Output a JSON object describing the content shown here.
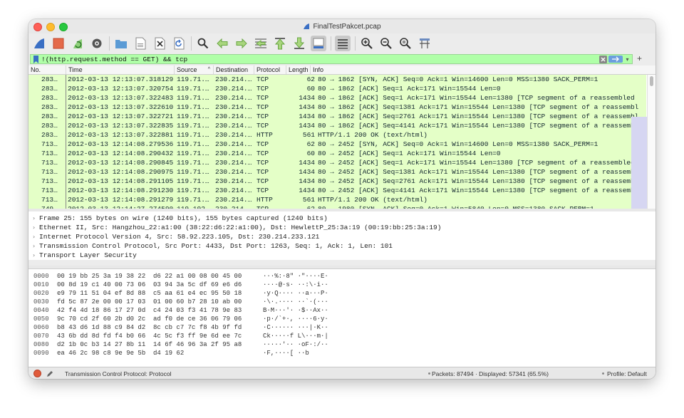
{
  "window": {
    "title": "FinalTestPakcet.pcap"
  },
  "toolbar": {
    "buttons": [
      "shark-fin-icon",
      "stop-capture-icon",
      "restart-capture-icon",
      "capture-options-icon",
      "open-file-icon",
      "save-file-icon",
      "close-file-icon",
      "reload-file-icon",
      "find-packet-icon",
      "go-back-icon",
      "go-forward-icon",
      "go-to-packet-icon",
      "go-first-icon",
      "go-last-icon",
      "auto-scroll-icon",
      "colorize-icon",
      "zoom-in-icon",
      "zoom-out-icon",
      "zoom-normal-icon",
      "resize-columns-icon"
    ]
  },
  "filter": {
    "value": "!(http.request.method == GET) && tcp",
    "add_label": "+"
  },
  "packet_list": {
    "columns": [
      "No.",
      "Time",
      "Source",
      "Destination",
      "Protocol",
      "Length",
      "Info"
    ],
    "rows": [
      {
        "no": "283…",
        "time": "2012-03-13 12:13:07.318129",
        "src": "119.71.…",
        "dst": "230.214.…",
        "proto": "TCP",
        "len": "62",
        "info": "80 → 1862 [SYN, ACK] Seq=0 Ack=1 Win=14600 Len=0 MSS=1380 SACK_PERM=1"
      },
      {
        "no": "283…",
        "time": "2012-03-13 12:13:07.320754",
        "src": "119.71.…",
        "dst": "230.214.…",
        "proto": "TCP",
        "len": "60",
        "info": "80 → 1862 [ACK] Seq=1 Ack=171 Win=15544 Len=0"
      },
      {
        "no": "283…",
        "time": "2012-03-13 12:13:07.322483",
        "src": "119.71.…",
        "dst": "230.214.…",
        "proto": "TCP",
        "len": "1434",
        "info": "80 → 1862 [ACK] Seq=1 Ack=171 Win=15544 Len=1380 [TCP segment of a reassembled"
      },
      {
        "no": "283…",
        "time": "2012-03-13 12:13:07.322610",
        "src": "119.71.…",
        "dst": "230.214.…",
        "proto": "TCP",
        "len": "1434",
        "info": "80 → 1862 [ACK] Seq=1381 Ack=171 Win=15544 Len=1380 [TCP segment of a reassembl"
      },
      {
        "no": "283…",
        "time": "2012-03-13 12:13:07.322721",
        "src": "119.71.…",
        "dst": "230.214.…",
        "proto": "TCP",
        "len": "1434",
        "info": "80 → 1862 [ACK] Seq=2761 Ack=171 Win=15544 Len=1380 [TCP segment of a reassembl"
      },
      {
        "no": "283…",
        "time": "2012-03-13 12:13:07.322835",
        "src": "119.71.…",
        "dst": "230.214.…",
        "proto": "TCP",
        "len": "1434",
        "info": "80 → 1862 [ACK] Seq=4141 Ack=171 Win=15544 Len=1380 [TCP segment of a reassembl"
      },
      {
        "no": "283…",
        "time": "2012-03-13 12:13:07.322881",
        "src": "119.71.…",
        "dst": "230.214.…",
        "proto": "HTTP",
        "len": "561",
        "info": "HTTP/1.1 200 OK  (text/html)"
      },
      {
        "no": "713…",
        "time": "2012-03-13 12:14:08.279536",
        "src": "119.71.…",
        "dst": "230.214.…",
        "proto": "TCP",
        "len": "62",
        "info": "80 → 2452 [SYN, ACK] Seq=0 Ack=1 Win=14600 Len=0 MSS=1380 SACK_PERM=1"
      },
      {
        "no": "713…",
        "time": "2012-03-13 12:14:08.290432",
        "src": "119.71.…",
        "dst": "230.214.…",
        "proto": "TCP",
        "len": "60",
        "info": "80 → 2452 [ACK] Seq=1 Ack=171 Win=15544 Len=0"
      },
      {
        "no": "713…",
        "time": "2012-03-13 12:14:08.290845",
        "src": "119.71.…",
        "dst": "230.214.…",
        "proto": "TCP",
        "len": "1434",
        "info": "80 → 2452 [ACK] Seq=1 Ack=171 Win=15544 Len=1380 [TCP segment of a reassembled"
      },
      {
        "no": "713…",
        "time": "2012-03-13 12:14:08.290975",
        "src": "119.71.…",
        "dst": "230.214.…",
        "proto": "TCP",
        "len": "1434",
        "info": "80 → 2452 [ACK] Seq=1381 Ack=171 Win=15544 Len=1380 [TCP segment of a reassembl"
      },
      {
        "no": "713…",
        "time": "2012-03-13 12:14:08.291105",
        "src": "119.71.…",
        "dst": "230.214.…",
        "proto": "TCP",
        "len": "1434",
        "info": "80 → 2452 [ACK] Seq=2761 Ack=171 Win=15544 Len=1380 [TCP segment of a reassembl"
      },
      {
        "no": "713…",
        "time": "2012-03-13 12:14:08.291230",
        "src": "119.71.…",
        "dst": "230.214.…",
        "proto": "TCP",
        "len": "1434",
        "info": "80 → 2452 [ACK] Seq=4141 Ack=171 Win=15544 Len=1380 [TCP segment of a reassembl"
      },
      {
        "no": "713…",
        "time": "2012-03-13 12:14:08.291279",
        "src": "119.71.…",
        "dst": "230.214.…",
        "proto": "HTTP",
        "len": "561",
        "info": "HTTP/1.1 200 OK  (text/html)"
      },
      {
        "no": "749…",
        "time": "2012-03-13 12:14:27.274590",
        "src": "119.192.…",
        "dst": "230.214.…",
        "proto": "TCP",
        "len": "62",
        "info": "80 → 1980 [SYN, ACK] Seq=0 Ack=1 Win=5840 Len=0 MSS=1380 SACK_PERM=1"
      }
    ]
  },
  "details": [
    "Frame 25: 155 bytes on wire (1240 bits), 155 bytes captured (1240 bits)",
    "Ethernet II, Src: Hangzhou_22:a1:00 (38:22:d6:22:a1:00), Dst: HewlettP_25:3a:19 (00:19:bb:25:3a:19)",
    "Internet Protocol Version 4, Src: 58.92.223.105, Dst: 230.214.233.121",
    "Transmission Control Protocol, Src Port: 4433, Dst Port: 1263, Seq: 1, Ack: 1, Len: 101",
    "Transport Layer Security"
  ],
  "bytes": [
    {
      "off": "0000",
      "hex": "00 19 bb 25 3a 19 38 22  d6 22 a1 00 08 00 45 00",
      "ascii": "···%:·8\" ·\"····E·"
    },
    {
      "off": "0010",
      "hex": "00 8d 19 c1 40 00 73 06  03 94 3a 5c df 69 e6 d6",
      "ascii": "····@·s· ··:\\·i··"
    },
    {
      "off": "0020",
      "hex": "e9 79 11 51 04 ef 8d 88  c5 aa 61 e4 ec 95 50 18",
      "ascii": "·y·Q···· ··a···P·"
    },
    {
      "off": "0030",
      "hex": "fd 5c 87 2e 00 00 17 03  01 00 60 b7 28 10 ab 00",
      "ascii": "·\\·.···· ··`·(···"
    },
    {
      "off": "0040",
      "hex": "42 f4 4d 18 86 17 27 0d  c4 24 03 f3 41 78 9e 83",
      "ascii": "B·M···'· ·$··Ax··"
    },
    {
      "off": "0050",
      "hex": "9c 70 cd 2f 60 2b d0 2c  ad f0 de ce 36 06 79 06",
      "ascii": "·p·/`+·, ····6·y·"
    },
    {
      "off": "0060",
      "hex": "b8 43 d6 1d 88 c9 84 d2  8c cb c7 7c f8 4b 9f fd",
      "ascii": "·C······ ···|·K··"
    },
    {
      "off": "0070",
      "hex": "43 6b dd 8d fd f4 b0 66  4c 5c f3 ff 9e 6d ee 7c",
      "ascii": "Ck·····f L\\···m·|"
    },
    {
      "off": "0080",
      "hex": "d2 1b 0c b3 14 27 8b 11  14 6f 46 96 3a 2f 95 a8",
      "ascii": "·····'·· ·oF·:/··"
    },
    {
      "off": "0090",
      "hex": "ea 46 2c 98 c8 9e 9e 5b  d4 19 62",
      "ascii": "·F,····[ ··b"
    }
  ],
  "status": {
    "protocol_text": "Transmission Control Protocol: Protocol",
    "packets_text": "Packets: 87494 · Displayed: 57341 (65.5%)",
    "profile_text": "Profile: Default"
  },
  "colors": {
    "row_bg": "#e4ffc7",
    "filter_bg": "#b0ffa8",
    "accent_blue": "#3a6fc4"
  }
}
